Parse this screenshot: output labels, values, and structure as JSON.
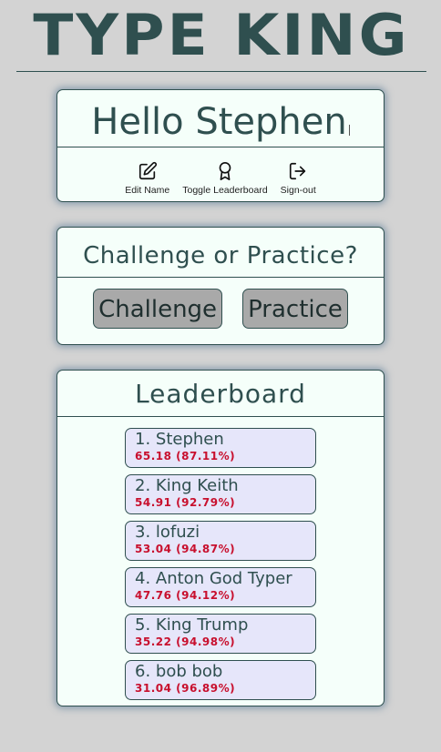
{
  "header": {
    "title": "TYPE KING"
  },
  "greeting_card": {
    "greeting": "Hello Stephen",
    "actions": [
      {
        "label": "Edit Name",
        "icon": "edit-icon"
      },
      {
        "label": "Toggle Leaderboard",
        "icon": "award-icon"
      },
      {
        "label": "Sign-out",
        "icon": "sign-out-icon"
      }
    ]
  },
  "mode_card": {
    "heading": "Challenge or Practice?",
    "challenge_label": "Challenge",
    "practice_label": "Practice"
  },
  "leaderboard": {
    "heading": "Leaderboard",
    "entries": [
      {
        "rank": "1",
        "name": "Stephen",
        "wpm": "65.18",
        "accuracy": "87.11%"
      },
      {
        "rank": "2",
        "name": "King Keith",
        "wpm": "54.91",
        "accuracy": "92.79%"
      },
      {
        "rank": "3",
        "name": "lofuzi",
        "wpm": "53.04",
        "accuracy": "94.87%"
      },
      {
        "rank": "4",
        "name": "Anton God Typer",
        "wpm": "47.76",
        "accuracy": "94.12%"
      },
      {
        "rank": "5",
        "name": "King Trump",
        "wpm": "35.22",
        "accuracy": "94.98%"
      },
      {
        "rank": "6",
        "name": "bob bob",
        "wpm": "31.04",
        "accuracy": "96.89%"
      }
    ]
  },
  "colors": {
    "background": "#d3d3d3",
    "text": "#2f4f4f",
    "card": "#f5fffa",
    "entry": "#e6e6fa",
    "score": "#c8102e",
    "button": "#a9a9a9"
  }
}
